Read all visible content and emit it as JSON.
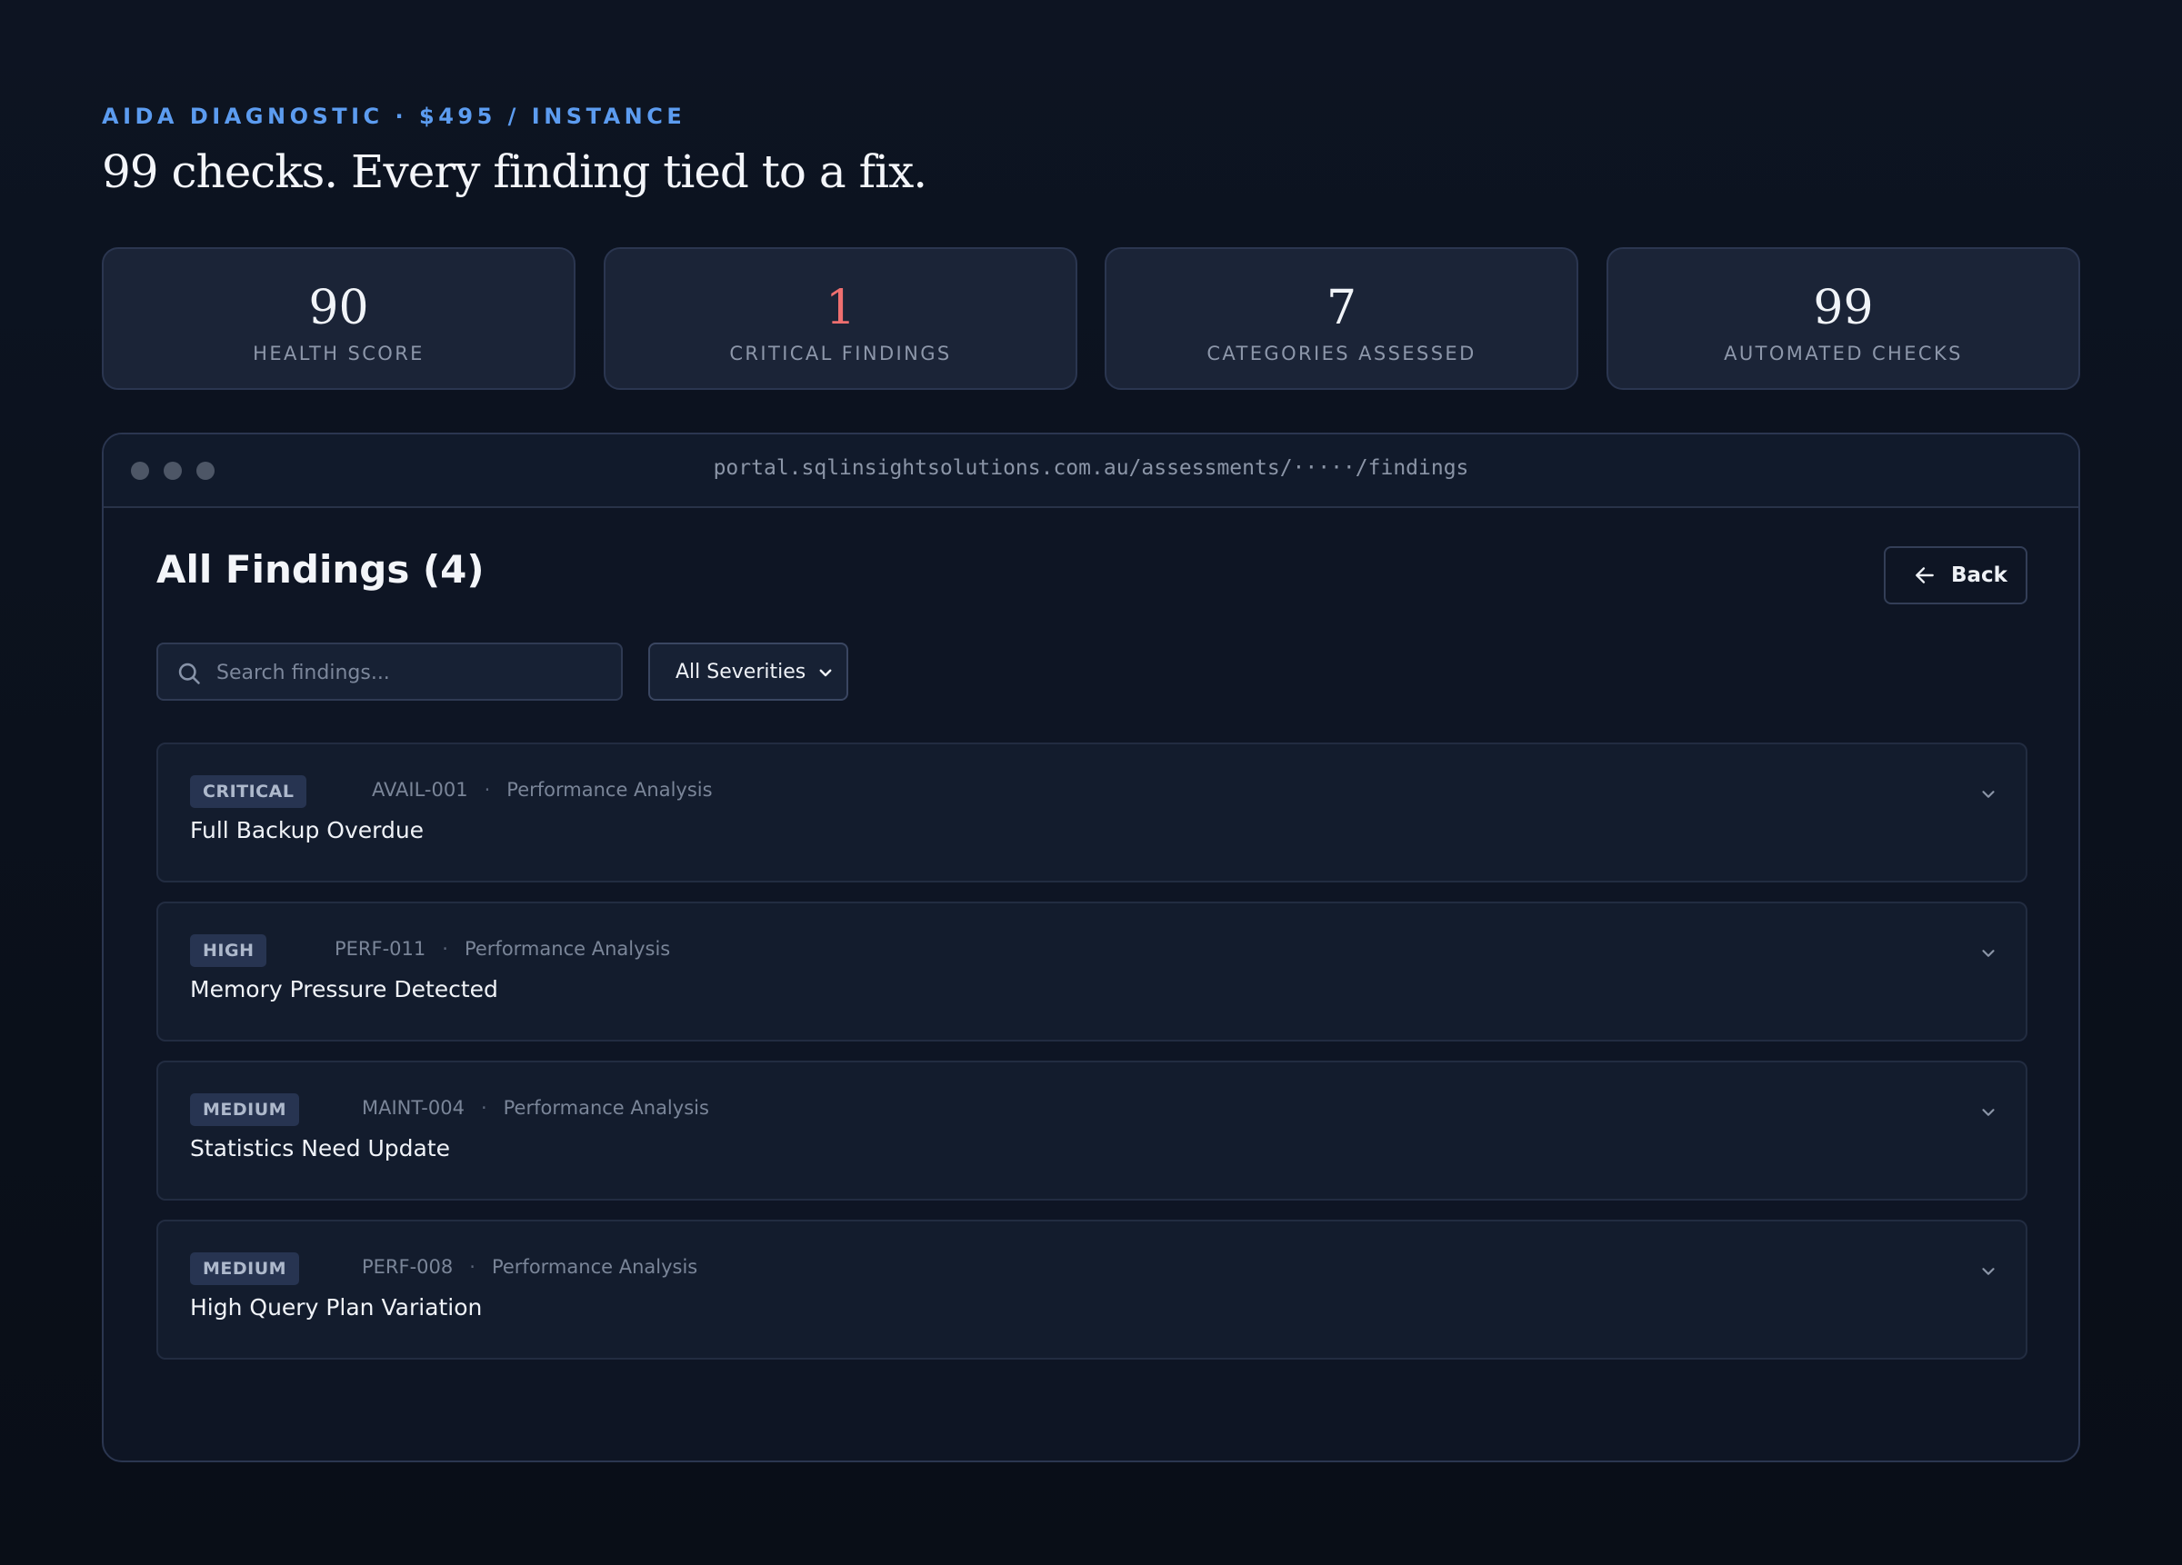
{
  "header": {
    "eyebrow": "AIDA DIAGNOSTIC · $495 / INSTANCE",
    "headline": "99 checks. Every finding tied to a fix."
  },
  "stats": [
    {
      "value": "90",
      "label": "HEALTH SCORE"
    },
    {
      "value": "1",
      "label": "CRITICAL FINDINGS"
    },
    {
      "value": "7",
      "label": "CATEGORIES ASSESSED"
    },
    {
      "value": "99",
      "label": "AUTOMATED CHECKS"
    }
  ],
  "colors": {
    "accent": "#5c9cf0",
    "critical": "#ee6f6f",
    "background": "#0b111c",
    "card": "#1b2437"
  },
  "window": {
    "url": "portal.sqlinsightsolutions.com.au/assessments/·····/findings"
  },
  "findings_page": {
    "title": "All Findings (4)",
    "back_label": "Back",
    "search_placeholder": "Search findings...",
    "severity_filter": "All Severities"
  },
  "findings": [
    {
      "severity": "CRITICAL",
      "id": "AVAIL-001",
      "category": "Performance Analysis",
      "title": "Full Backup Overdue"
    },
    {
      "severity": "HIGH",
      "id": "PERF-011",
      "category": "Performance Analysis",
      "title": "Memory Pressure Detected"
    },
    {
      "severity": "MEDIUM",
      "id": "MAINT-004",
      "category": "Performance Analysis",
      "title": "Statistics Need Update"
    },
    {
      "severity": "MEDIUM",
      "id": "PERF-008",
      "category": "Performance Analysis",
      "title": "High Query Plan Variation"
    }
  ],
  "icons": {
    "search": "search-icon",
    "back": "arrow-left-icon",
    "select": "chevron-down-icon",
    "expand": "chevron-down-icon"
  }
}
